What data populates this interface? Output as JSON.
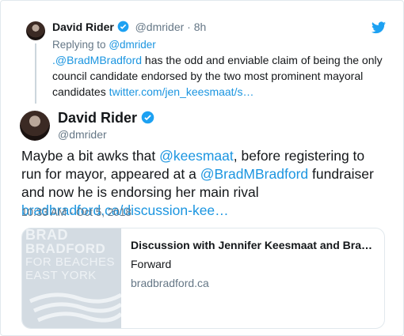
{
  "reply": {
    "name": "David Rider",
    "handle": "@dmrider",
    "time": "· 8h",
    "replying_label": "Replying to",
    "replying_to": "@dmrider",
    "text_mention": ".@BradMBradford",
    "text_body": " has the odd and enviable claim of being the only council candidate endorsed by the two most prominent mayoral candidates ",
    "text_link": "twitter.com/jen_keesmaat/s…"
  },
  "main": {
    "name": "David Rider",
    "handle": "@dmrider",
    "text_1": "Maybe a bit awks that ",
    "mention_1": "@keesmaat",
    "text_2": ", before registering to run for mayor, appeared at a ",
    "mention_2": "@BradMBradford",
    "text_3": " fundraiser and now he is endorsing her main rival ",
    "link": "bradbradford.ca/discussion-kee…",
    "timestamp": "10:33 AM - Oct 5, 2018"
  },
  "card": {
    "image_lines": [
      "BRAD",
      "BRADFORD",
      "FOR BEACHES",
      "EAST YORK"
    ],
    "title": "Discussion with Jennifer Keesmaat and Bra…",
    "description": "Forward",
    "domain": "bradbradford.ca"
  },
  "colors": {
    "link": "#1b95e0",
    "verified": "#1da1f2",
    "muted": "#657786"
  },
  "icons": {
    "verified": "verified-badge-icon",
    "twitter": "twitter-bird-icon"
  }
}
